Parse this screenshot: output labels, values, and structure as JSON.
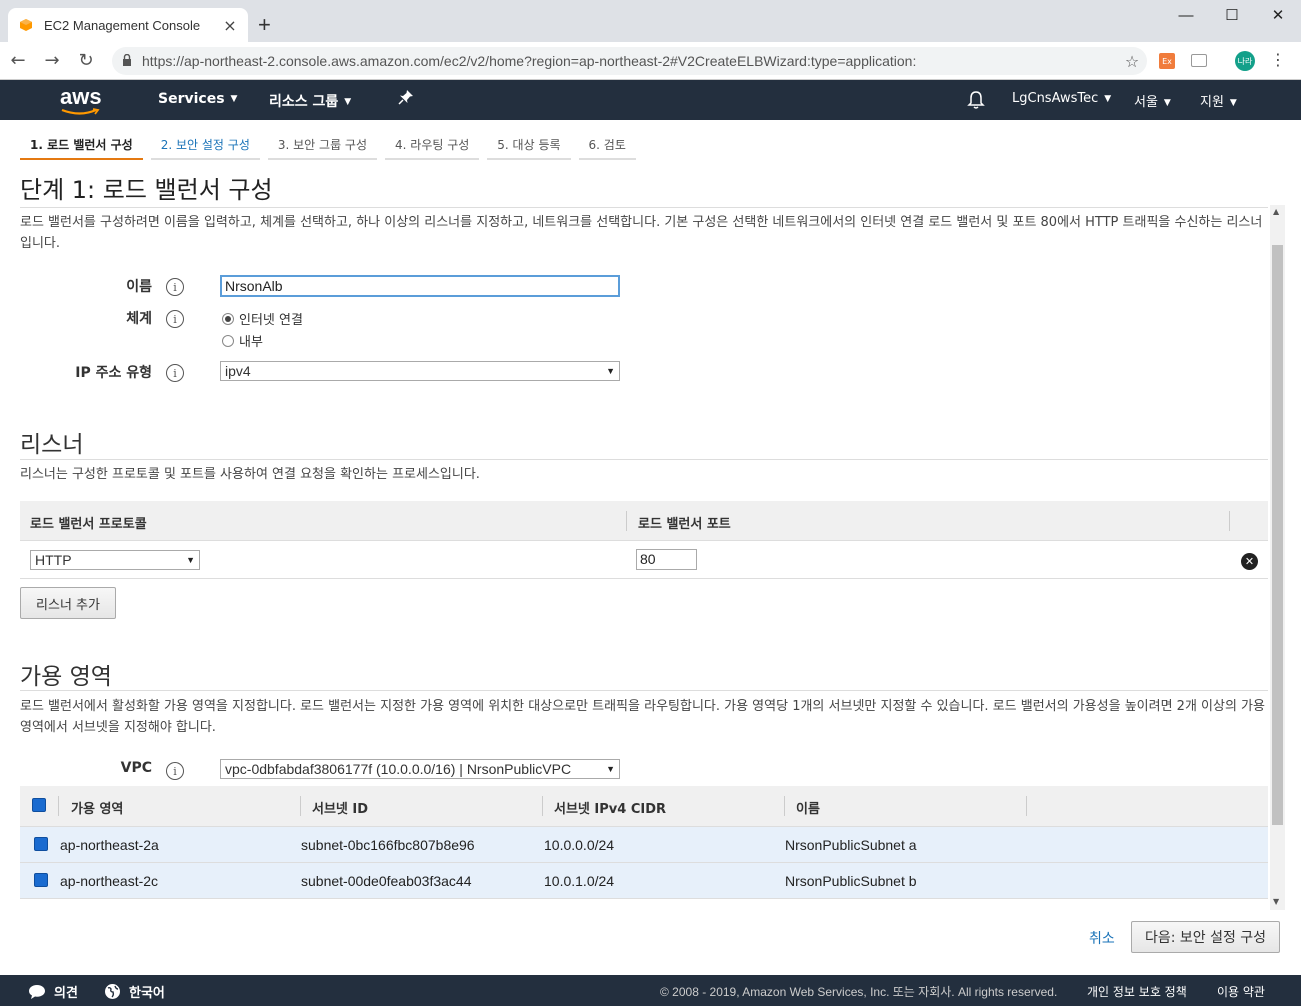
{
  "browser": {
    "tab_title": "EC2 Management Console",
    "url": "https://ap-northeast-2.console.aws.amazon.com/ec2/v2/home?region=ap-northeast-2#V2CreateELBWizard:type=application:",
    "ext_label": "Ex",
    "avatar_label": "나라"
  },
  "aws_nav": {
    "logo": "aws",
    "services": "Services",
    "resource_groups": "리소스 그룹",
    "account": "LgCnsAwsTec",
    "region": "서울",
    "support": "지원"
  },
  "wizard": {
    "steps": [
      "1. 로드 밸런서 구성",
      "2. 보안 설정 구성",
      "3. 보안 그룹 구성",
      "4. 라우팅 구성",
      "5. 대상 등록",
      "6. 검토"
    ],
    "title": "단계 1: 로드 밸런서 구성",
    "intro": "로드 밸런서를 구성하려면 이름을 입력하고, 체계를 선택하고, 하나 이상의 리스너를 지정하고, 네트워크를 선택합니다. 기본 구성은 선택한 네트워크에서의 인터넷 연결 로드 밸런서 및 포트 80에서 HTTP 트래픽을 수신하는 리스너입니다."
  },
  "basic": {
    "name_label": "이름",
    "name_value": "NrsonAlb",
    "scheme_label": "체계",
    "scheme_options": [
      "인터넷 연결",
      "내부"
    ],
    "scheme_selected": 0,
    "ip_label": "IP 주소 유형",
    "ip_value": "ipv4"
  },
  "listeners": {
    "title": "리스너",
    "desc": "리스너는 구성한 프로토콜 및 포트를 사용하여 연결 요청을 확인하는 프로세스입니다.",
    "col_protocol": "로드 밸런서 프로토콜",
    "col_port": "로드 밸런서 포트",
    "rows": [
      {
        "protocol": "HTTP",
        "port": "80"
      }
    ],
    "add_button": "리스너 추가"
  },
  "az": {
    "title": "가용 영역",
    "desc": "로드 밸런서에서 활성화할 가용 영역을 지정합니다. 로드 밸런서는 지정한 가용 영역에 위치한 대상으로만 트래픽을 라우팅합니다. 가용 영역당 1개의 서브넷만 지정할 수 있습니다. 로드 밸런서의 가용성을 높이려면 2개 이상의 가용 영역에서 서브넷을 지정해야 합니다.",
    "vpc_label": "VPC",
    "vpc_value": "vpc-0dbfabdaf3806177f (10.0.0.0/16) | NrsonPublicVPC",
    "columns": [
      "가용 영역",
      "서브넷 ID",
      "서브넷 IPv4 CIDR",
      "이름"
    ],
    "rows": [
      {
        "zone": "ap-northeast-2a",
        "subnet": "subnet-0bc166fbc807b8e96",
        "cidr": "10.0.0.0/24",
        "name": "NrsonPublicSubnet a"
      },
      {
        "zone": "ap-northeast-2c",
        "subnet": "subnet-00de0feab03f3ac44",
        "cidr": "10.0.1.0/24",
        "name": "NrsonPublicSubnet b"
      }
    ]
  },
  "actions": {
    "cancel": "취소",
    "next": "다음: 보안 설정 구성"
  },
  "footer": {
    "feedback": "의견",
    "language": "한국어",
    "copyright": "© 2008 - 2019, Amazon Web Services, Inc. 또는 자회사. All rights reserved.",
    "privacy": "개인 정보 보호 정책",
    "terms": "이용 약관"
  }
}
